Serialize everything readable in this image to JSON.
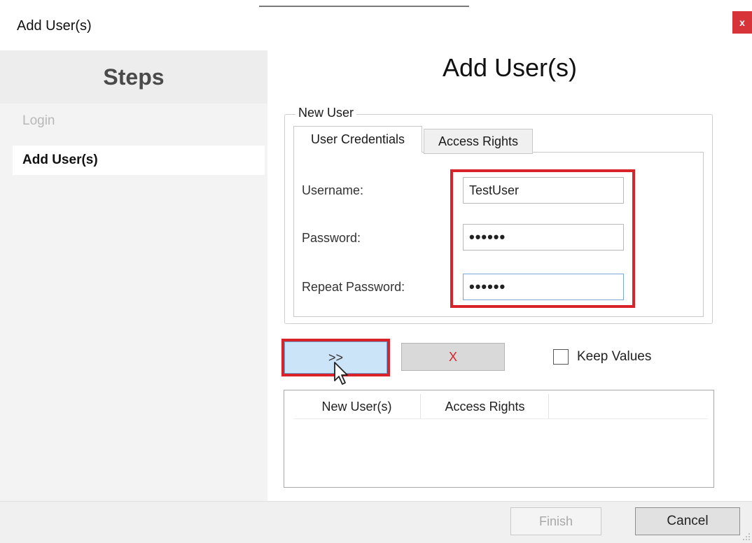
{
  "window": {
    "title": "Add User(s)",
    "close_label": "x"
  },
  "steps": {
    "header": "Steps",
    "items": [
      {
        "label": "Login",
        "state": "inactive"
      },
      {
        "label": "Add User(s)",
        "state": "active"
      }
    ]
  },
  "main": {
    "heading": "Add User(s)",
    "group_title": "New User",
    "tabs": [
      {
        "label": "User Credentials",
        "selected": true
      },
      {
        "label": "Access Rights",
        "selected": false
      }
    ],
    "fields": {
      "username_label": "Username:",
      "username_value": "TestUser",
      "password_label": "Password:",
      "password_value": "••••••",
      "repeat_label": "Repeat Password:",
      "repeat_value": "••••••"
    },
    "add_button": ">>",
    "clear_button": "X",
    "keep_values_label": "Keep Values",
    "keep_values_checked": false,
    "list_columns": [
      "New User(s)",
      "Access Rights"
    ]
  },
  "footer": {
    "finish_label": "Finish",
    "cancel_label": "Cancel"
  },
  "colors": {
    "highlight": "#d8232a",
    "close_button": "#d7343a",
    "add_button_bg": "#cce4f7"
  },
  "icons": {
    "cursor": "mouse-pointer-icon",
    "close": "close-icon"
  }
}
